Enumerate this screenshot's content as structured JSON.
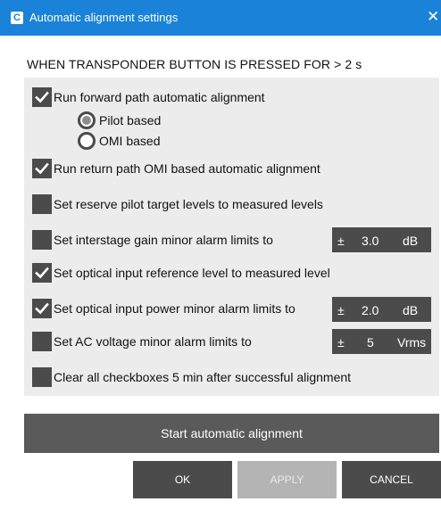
{
  "window": {
    "title": "Automatic alignment settings",
    "app_icon_letter": "C",
    "close_glyph": "✕"
  },
  "header_label": "WHEN TRANSPONDER BUTTON IS PRESSED FOR  > 2 s",
  "options": {
    "forward": {
      "label": "Run forward path automatic alignment",
      "checked": true
    },
    "pilot": {
      "label": "Pilot based",
      "selected": true
    },
    "omi": {
      "label": "OMI based",
      "selected": false
    },
    "return": {
      "label": "Run return path OMI based automatic alignment",
      "checked": true
    },
    "reserve": {
      "label": "Set reserve pilot target levels to measured levels",
      "checked": false
    },
    "interstage": {
      "label": "Set interstage gain minor alarm limits to",
      "checked": false,
      "pm": "±",
      "value": "3.0",
      "unit": "dB"
    },
    "optref": {
      "label": "Set optical input reference level to measured level",
      "checked": true
    },
    "optpower": {
      "label": "Set optical input power minor alarm limits to",
      "checked": true,
      "pm": "±",
      "value": "2.0",
      "unit": "dB"
    },
    "acvolt": {
      "label": "Set AC voltage minor alarm limits to",
      "checked": false,
      "pm": "±",
      "value": "5",
      "unit": "Vrms"
    },
    "clear": {
      "label": "Clear all checkboxes 5 min after successful alignment",
      "checked": false
    }
  },
  "buttons": {
    "start": "Start automatic alignment",
    "ok": "OK",
    "apply": "APPLY",
    "cancel": "CANCEL"
  },
  "colors": {
    "titlebar": "#1a82d8",
    "control": "#4b4b4b",
    "panel": "#ececec",
    "disabled": "#b4b4b4"
  }
}
